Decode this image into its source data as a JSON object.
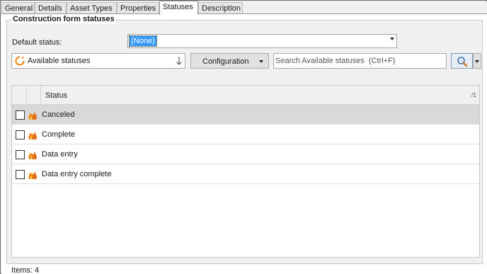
{
  "tabs": [
    {
      "label": "General",
      "active": false
    },
    {
      "label": "Details",
      "active": false
    },
    {
      "label": "Asset Types",
      "active": false
    },
    {
      "label": "Properties",
      "active": false
    },
    {
      "label": "Statuses",
      "active": true
    },
    {
      "label": "Description",
      "active": false
    }
  ],
  "group": {
    "title": "Construction form statuses"
  },
  "default_status": {
    "label": "Default status:",
    "value": "(None)"
  },
  "filter": {
    "view_label": "Available statuses",
    "configuration_label": "Configuration",
    "search_placeholder": "Search Available statuses  (Ctrl+F)"
  },
  "grid": {
    "column_header": "Status",
    "sort_indicator": "1",
    "rows": [
      {
        "label": "Canceled",
        "selected": true
      },
      {
        "label": "Complete",
        "selected": false
      },
      {
        "label": "Data entry",
        "selected": false
      },
      {
        "label": "Data entry complete",
        "selected": false
      }
    ]
  },
  "status_bar": {
    "items_text": "Items: 4"
  },
  "colors": {
    "selection": "#3399ff",
    "selected_row": "#d9d9d9",
    "icon_orange": "#f08c1e"
  }
}
